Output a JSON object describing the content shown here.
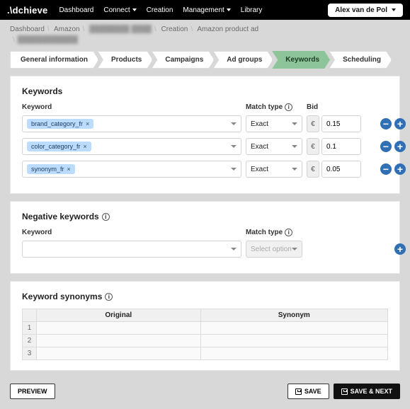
{
  "brand": ".\\dchieve",
  "topnav": [
    "Dashboard",
    "Connect",
    "Creation",
    "Management",
    "Library"
  ],
  "topnav_has_caret": [
    false,
    true,
    false,
    true,
    false
  ],
  "user": "Alex van de Pol",
  "breadcrumbs": {
    "line1": [
      "Dashboard",
      "Amazon",
      "████████ ████",
      "Creation",
      "Amazon product ad"
    ],
    "line2_obscured": "████████████"
  },
  "tabs": [
    "General information",
    "Products",
    "Campaigns",
    "Ad groups",
    "Keywords",
    "Scheduling"
  ],
  "active_tab_index": 4,
  "keywords_panel": {
    "title": "Keywords",
    "col_keyword": "Keyword",
    "col_match": "Match type",
    "col_bid": "Bid",
    "rows": [
      {
        "token": "brand_category_fr",
        "match": "Exact",
        "currency": "€",
        "bid": "0.15"
      },
      {
        "token": "color_category_fr",
        "match": "Exact",
        "currency": "€",
        "bid": "0.1"
      },
      {
        "token": "synonym_fr",
        "match": "Exact",
        "currency": "€",
        "bid": "0.05"
      }
    ]
  },
  "negative_panel": {
    "title": "Negative keywords",
    "col_keyword": "Keyword",
    "col_match": "Match type",
    "match_placeholder": "Select option"
  },
  "synonyms_panel": {
    "title": "Keyword synonyms",
    "col_original": "Original",
    "col_synonym": "Synonym",
    "row_nums": [
      "1",
      "2",
      "3"
    ]
  },
  "buttons": {
    "preview": "PREVIEW",
    "save": "SAVE",
    "save_next": "SAVE & NEXT"
  }
}
